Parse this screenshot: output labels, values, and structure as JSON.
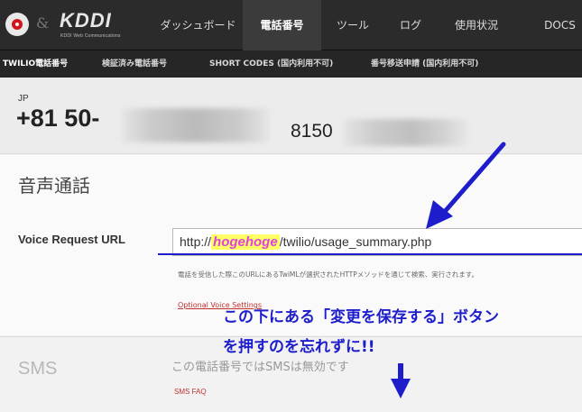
{
  "logo": {
    "ampersand": "&",
    "kddi": "KDDI",
    "subtitle": "KDDI Web Communications"
  },
  "nav": {
    "items": [
      {
        "label": "ダッシュボード"
      },
      {
        "label": "電話番号"
      },
      {
        "label": "ツール"
      },
      {
        "label": "ログ"
      },
      {
        "label": "使用状況"
      },
      {
        "label": "DOCS"
      }
    ],
    "active_index": 1
  },
  "subnav": {
    "items": [
      {
        "label": "TWILIO電話番号"
      },
      {
        "label": "検証済み電話番号"
      },
      {
        "label": "SHORT CODES (国内利用不可)"
      },
      {
        "label": "番号移送申請 (国内利用不可)"
      }
    ],
    "active_index": 0
  },
  "number": {
    "country": "JP",
    "prefix": "+81 50-",
    "short_prefix": "8150"
  },
  "voice": {
    "title": "音声通話",
    "request_url_label": "Voice Request URL",
    "url_prefix": "http://",
    "url_highlight": "hogehoge",
    "url_suffix": "/twilio/usage_summary.php",
    "help_text": "電話を受信した際このURLにあるTwiMLが選択されたHTTPメソッドを通じて検索、実行されます。",
    "optional_link": "Optional Voice Settings"
  },
  "annotation": {
    "line1": "この下にある「変更を保存する」ボタン",
    "line2": "を押すのを忘れずに!!",
    "color": "#1d1dcc"
  },
  "sms": {
    "title": "SMS",
    "disabled_text": "この電話番号ではSMSは無効です",
    "faq_link": "SMS FAQ"
  }
}
